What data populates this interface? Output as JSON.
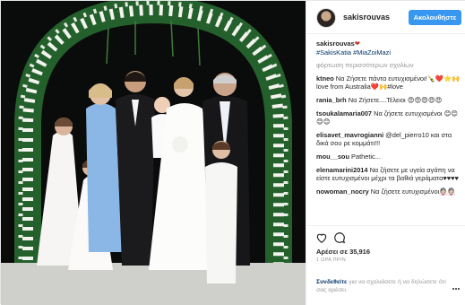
{
  "header": {
    "username": "sakisrouvas",
    "follow_label": "Ακολουθήστε"
  },
  "caption": {
    "username": "sakisrouvas",
    "hashtags": "#SakisKatia #MiaZoiMazi"
  },
  "load_more_label": "φόρτωση περισσότερων σχολίων",
  "comments": [
    {
      "user": "ktneo",
      "text": "Να Ζήσετε πάντα ευτυχισμένοι!🍾❤️⭐🙌love from Australia❤️🙌#love"
    },
    {
      "user": "rania_brh",
      "text": "Να Ζήσετε....Τέλειοι 😍😍😍😍😍"
    },
    {
      "user": "tsoukalamaria007",
      "text": "Να ζήσετε ευτυχισμένοι 😊😊😊😊"
    },
    {
      "user": "elisavet_mavrogianni",
      "text": "@del_pierro10 και στα δικά σου ρε κομμάτι!!!"
    },
    {
      "user": "mou__sou",
      "text": "Pathetic..."
    },
    {
      "user": "elenamarini2014",
      "text": "Να ζήσετε με υγεία αγάπη να είστε ευτυχισμένοι μέχρι τα βαθιά γεράματα♥♥♥♥"
    },
    {
      "user": "nowoman_nocry",
      "text": "Να ζήσετε ευτυχισμένοι👰🏻👰🏻"
    }
  ],
  "actions": {
    "likes": "Αρέσει σε 35,916",
    "time": "1 ΩΡΑ ΠΡΙΝ"
  },
  "login_prompt": {
    "link": "Συνδεθείτε",
    "text": " για να σχολιάσετε ή να δηλώσετε ότι σας αρέσει."
  },
  "icons": [
    "heart-icon",
    "comment-icon",
    "more-options-icon"
  ],
  "colors": {
    "accent": "#3897f0",
    "link": "#003569",
    "muted": "#999999"
  }
}
